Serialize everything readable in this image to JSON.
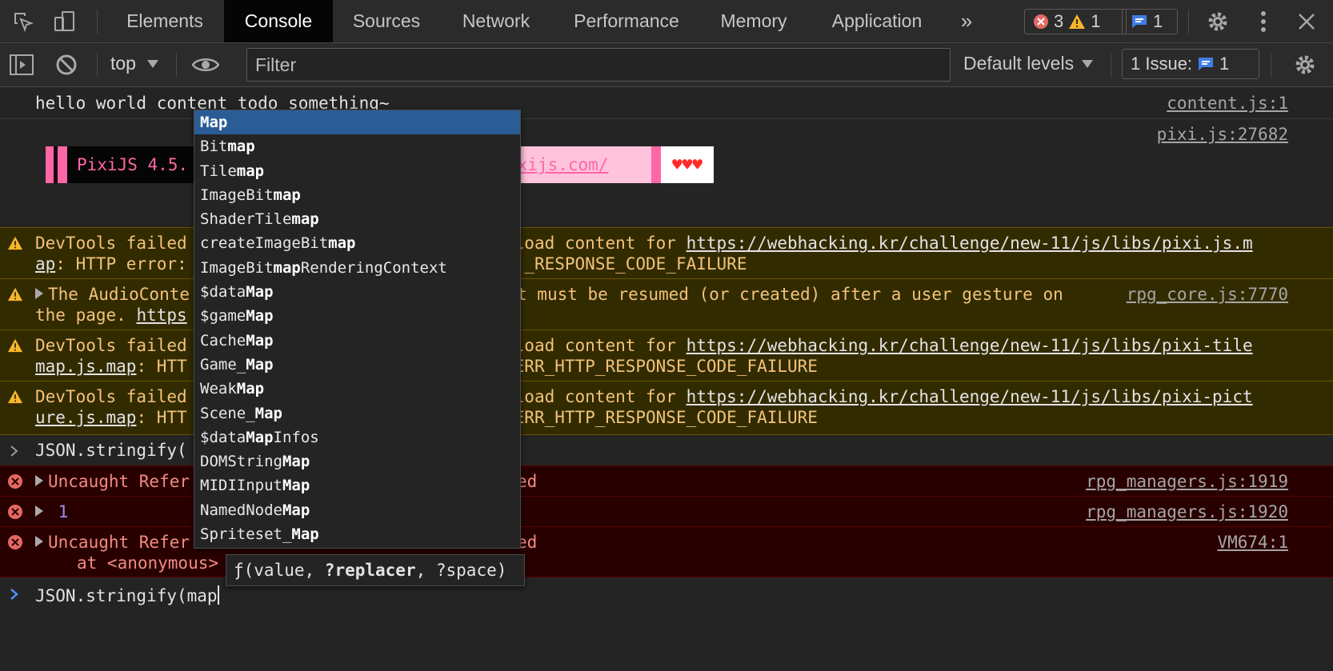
{
  "tabs": [
    "Elements",
    "Console",
    "Sources",
    "Network",
    "Performance",
    "Memory",
    "Application"
  ],
  "more_tabs": "»",
  "counters": {
    "errors": "3",
    "warnings": "1",
    "messages": "1"
  },
  "toolbar": {
    "context": "top",
    "filter_placeholder": "Filter",
    "levels": "Default levels",
    "issues_label": "1 Issue:",
    "issues_count": "1"
  },
  "console": {
    "log1": {
      "text": "hello world content todo something~",
      "source": "content.js:1"
    },
    "pixi": {
      "source": "pixi.js:27682",
      "banner_left": "PixiJS 4.5.",
      "banner_right": "ixijs.com/",
      "hearts": "♥♥♥"
    },
    "warn1": {
      "l1_a": "DevTools failed",
      "l1_b": "load content for ",
      "l1_link": "https://webhacking.kr/challenge/new-11/js/libs/pixi.js.m",
      "l2_link": "ap",
      "l2_a": ": HTTP error: ",
      "l2_b": "_RESPONSE_CODE_FAILURE"
    },
    "warn2": {
      "l1_a": "The AudioConte",
      "l1_b": "t must be resumed (or created) after a user gesture on",
      "l2_a": "the page. ",
      "l2_link": "https",
      "source": "rpg_core.js:7770"
    },
    "warn3": {
      "l1_a": "DevTools failed",
      "l1_b": "load content for ",
      "l1_link": "https://webhacking.kr/challenge/new-11/js/libs/pixi-tile",
      "l2_link": "map.js.map",
      "l2_a": ": HTT",
      "l2_b": "ERR_HTTP_RESPONSE_CODE_FAILURE"
    },
    "warn4": {
      "l1_a": "DevTools failed",
      "l1_b": "load content for ",
      "l1_link": "https://webhacking.kr/challenge/new-11/js/libs/pixi-pict",
      "l2_link": "ure.js.map",
      "l2_a": ": HTT",
      "l2_b": "ERR_HTTP_RESPONSE_CODE_FAILURE"
    },
    "input1": "JSON.stringify(",
    "err1": {
      "a": "Uncaught Refer",
      "b": "ed",
      "source": "rpg_managers.js:1919"
    },
    "err2": {
      "value": "1",
      "source": "rpg_managers.js:1920"
    },
    "err3": {
      "a": "Uncaught Refer",
      "b": "ed",
      "l2": "at <anonymous>",
      "source": "VM674:1"
    },
    "prompt_text": "JSON.stringify(map"
  },
  "autocomplete": {
    "items": [
      [
        "",
        "Map",
        ""
      ],
      [
        "Bit",
        "map",
        ""
      ],
      [
        "Tile",
        "map",
        ""
      ],
      [
        "ImageBit",
        "map",
        ""
      ],
      [
        "ShaderTile",
        "map",
        ""
      ],
      [
        "createImageBit",
        "map",
        ""
      ],
      [
        "ImageBit",
        "map",
        "RenderingContext"
      ],
      [
        "$data",
        "Map",
        ""
      ],
      [
        "$game",
        "Map",
        ""
      ],
      [
        "Cache",
        "Map",
        ""
      ],
      [
        "Game_",
        "Map",
        ""
      ],
      [
        "Weak",
        "Map",
        ""
      ],
      [
        "Scene_",
        "Map",
        ""
      ],
      [
        "$data",
        "Map",
        "Infos"
      ],
      [
        "DOMString",
        "Map",
        ""
      ],
      [
        "MIDIInput",
        "Map",
        ""
      ],
      [
        "NamedNode",
        "Map",
        ""
      ],
      [
        "Spriteset_",
        "Map",
        ""
      ]
    ],
    "signature": {
      "prefix": "ƒ(value, ",
      "bold": "?replacer",
      "suffix": ", ?space)"
    }
  },
  "colors": {
    "warning_bg": "#332b00",
    "error_bg": "#290000",
    "selected": "#2a5d96",
    "prompt": "#4d8ef7"
  }
}
